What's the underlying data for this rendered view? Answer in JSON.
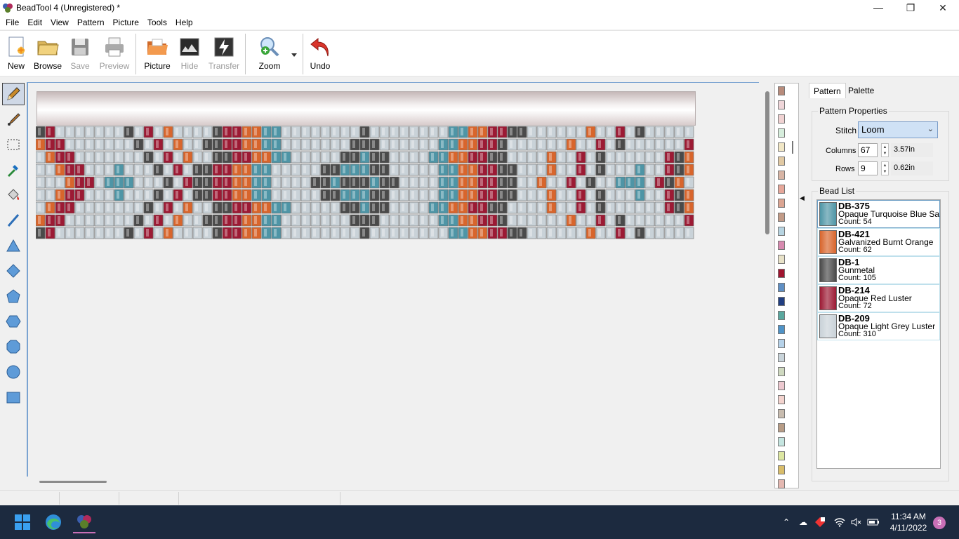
{
  "window": {
    "title": "BeadTool 4 (Unregistered) *"
  },
  "menu": [
    "File",
    "Edit",
    "View",
    "Pattern",
    "Picture",
    "Tools",
    "Help"
  ],
  "toolbar": {
    "new": "New",
    "browse": "Browse",
    "save": "Save",
    "preview": "Preview",
    "picture": "Picture",
    "hide": "Hide",
    "transfer": "Transfer",
    "zoom": "Zoom",
    "undo": "Undo"
  },
  "tools": [
    "pencil-icon",
    "brush-icon",
    "select-rect-icon",
    "eyedropper-icon",
    "fill-bucket-icon",
    "line-icon",
    "triangle-icon",
    "diamond-icon",
    "pentagon-icon",
    "hexagon-icon",
    "octagon-icon",
    "circle-icon",
    "rectangle-icon"
  ],
  "tabs": [
    "Pattern",
    "Palette"
  ],
  "pattern_properties": {
    "title": "Pattern Properties",
    "stitch_label": "Stitch",
    "stitch_value": "Loom",
    "columns_label": "Columns",
    "columns_value": "67",
    "columns_inches": "3.57in",
    "rows_label": "Rows",
    "rows_value": "9",
    "rows_inches": "0.62in"
  },
  "bead_list": {
    "title": "Bead List",
    "items": [
      {
        "code": "DB-375",
        "name": "Opaque Turquoise Blue Satin",
        "count": "Count: 54",
        "color": "#4e95a6"
      },
      {
        "code": "DB-421",
        "name": "Galvanized Burnt Orange",
        "count": "Count: 62",
        "color": "#d8652c"
      },
      {
        "code": "DB-1",
        "name": "Gunmetal",
        "count": "Count: 105",
        "color": "#4a4a4a"
      },
      {
        "code": "DB-214",
        "name": "Opaque Red Luster",
        "count": "Count: 72",
        "color": "#9c1a34"
      },
      {
        "code": "DB-209",
        "name": "Opaque Light Grey Luster",
        "count": "Count: 310",
        "color": "#c9d2d8"
      }
    ]
  },
  "bead_pattern": {
    "columns": 67,
    "rows": 9,
    "legend": {
      "L": "DB-209",
      "K": "DB-1",
      "R": "DB-214",
      "O": "DB-421",
      "T": "DB-375"
    },
    "grid": [
      "KRLLLLLLLKLRLOLLLLKRROOTTLLLLLLLLKLLLLLLLLTTOORRKKLLLLLLOLLRLKLLLLLRK",
      "ORRLLLLLLLKLRLOLLKKRROOTTLLLLLLLKKKLLLLLLTTOORRKLLLLLLOLLRLKLLLLLLRKO",
      "LORRLLLLLLLKLRLOLLKKRROOTTLLLLLKKTKKLLLLTTOORRKKLLLLOLLRLKLLLLLLRKOLL",
      "LLORRLLLTLLLKLRLKKRROOTTLLLLLKKTTTKKLLLLLTTOORRKKLLLOLLRLKLLLTLLRKOLL",
      "LLLORRLTTTLLLKLRKKRROOTTLLLLKKTKKKTKKLLLLTTOORRKKLLOLLRLKLLTTTLRKOLLL",
      "LLORRLLLTLLLKLRLKKRROOTTLLLLLKKTTTKKLLLLLTTOORRKKLLLOLLRLKLLLTLLRKOLL",
      "LORRLLLLLLLKLRLOLLKKRROOTTLLLLLKKTKKLLLLTTOORRKKLLLLOLLRLKLLLLLLRKOLL",
      "ORRLLLLLLLKLRLOLLKKRROOTTLLLLLLLKKKLLLLLLTTOORRKLLLLLLOLLRLKLLLLLLRKO",
      "KRLLLLLLLKLRLOLLLLKRROOTTLLLLLLLLKLLLLLLLLTTOORRKKLLLLLLOLLRLKLLLLLRK"
    ]
  },
  "palette_strip": [
    "#b88c7c",
    "#efd6d9",
    "#f0d2d2",
    "#d7eedd",
    "#f1e7c6",
    "#e1c9a3",
    "#d8b5a5",
    "#e6a79a",
    "#dba592",
    "#c29b87",
    "#b7d4e1",
    "#d88ab0",
    "#e8e2c8",
    "#a0142f",
    "#5f8fc4",
    "#213f82",
    "#5aa89f",
    "#4f93c7",
    "#b6d2e9",
    "#c9d4da",
    "#cfd9c0",
    "#edc9d0",
    "#f3d3ce",
    "#c8bcaf",
    "#b79c86",
    "#c5e5e0",
    "#dde7a2",
    "#d9bd6a",
    "#e4b8b1",
    "#e98b86",
    "#d79da0"
  ],
  "taskbar": {
    "time": "11:34 AM",
    "date": "4/11/2022",
    "notifications": "3"
  }
}
